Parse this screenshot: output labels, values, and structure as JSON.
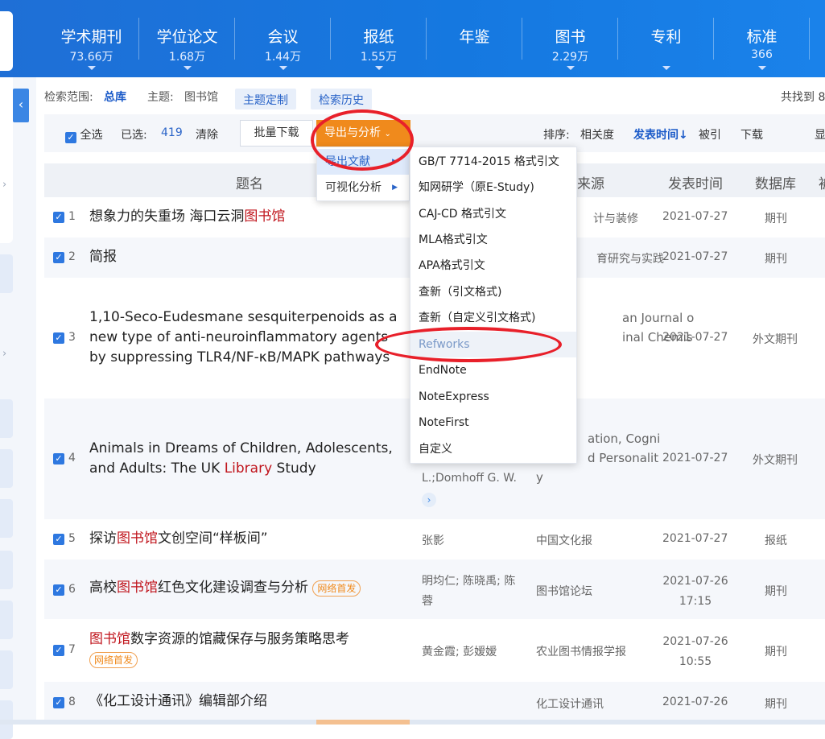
{
  "databases": [
    {
      "name": "学术期刊",
      "count": "73.66万"
    },
    {
      "name": "学位论文",
      "count": "1.68万"
    },
    {
      "name": "会议",
      "count": "1.44万"
    },
    {
      "name": "报纸",
      "count": "1.55万"
    },
    {
      "name": "年鉴",
      "count": ""
    },
    {
      "name": "图书",
      "count": "2.29万"
    },
    {
      "name": "专利",
      "count": ""
    },
    {
      "name": "标准",
      "count": "366"
    }
  ],
  "filter": {
    "scope_label": "检索范围:",
    "scope_value": "总库",
    "topic_label": "主题:",
    "topic_value": "图书馆",
    "customize_button": "主题定制",
    "history_button": "检索历史",
    "found_label": "共找到 8"
  },
  "toolbar": {
    "select_all": "全选",
    "selected_label": "已选:",
    "selected_count": "419",
    "clear": "清除",
    "batch_download": "批量下载",
    "export_analyze": "导出与分析",
    "sort_label": "排序:",
    "sort_relevance": "相关度",
    "sort_date": "发表时间",
    "sort_cited": "被引",
    "sort_download": "下载",
    "display": "显"
  },
  "table_headers": {
    "title": "题名",
    "source": "来源",
    "date": "发表时间",
    "database": "数据库",
    "extra": "被"
  },
  "menu_level1": [
    {
      "label": "导出文献"
    },
    {
      "label": "可视化分析"
    }
  ],
  "menu_level2": [
    {
      "label": "GB/T 7714-2015 格式引文"
    },
    {
      "label": "知网研学（原E-Study)"
    },
    {
      "label": "CAJ-CD 格式引文"
    },
    {
      "label": "MLA格式引文"
    },
    {
      "label": "APA格式引文"
    },
    {
      "label": "查新（引文格式)"
    },
    {
      "label": "查新（自定义引文格式)"
    },
    {
      "label": "Refworks"
    },
    {
      "label": "EndNote"
    },
    {
      "label": "NoteExpress"
    },
    {
      "label": "NoteFirst"
    },
    {
      "label": "自定义"
    }
  ],
  "rows": [
    {
      "num": "1",
      "title_a": "想象力的失重场 海口云洞",
      "title_hl": "图书馆",
      "title_b": "",
      "author": "",
      "source": "计与装修",
      "date": "2021-07-27",
      "time": "",
      "db": "期刊"
    },
    {
      "num": "2",
      "title_a": "简报",
      "title_hl": "",
      "title_b": "",
      "author": "",
      "source": "育研究与实践",
      "date": "2021-07-27",
      "time": "",
      "db": "期刊"
    },
    {
      "num": "3",
      "title_line1": "1,10-Seco-Eudesmane sesquiterpenoids as a",
      "title_line2": "new type of anti-neuroinflammatory agents",
      "title_line3": "by suppressing TLR4/NF-κB/MAPK pathways",
      "source_line1": "an Journal o",
      "source_line2": "inal Chemis",
      "date": "2021-07-27",
      "db": "外文期刊"
    },
    {
      "num": "4",
      "title_line1": "Animals in Dreams of Children, Adolescents,",
      "title_line2_a": "and Adults: The UK ",
      "title_line2_hl": "Library",
      "title_line2_b": " Study",
      "author_line": "L.;Domhoff G. W.",
      "source_line1": "ation, Cogni",
      "source_line2": "d Personalit",
      "source_line3": "y",
      "date": "2021-07-27",
      "db": "外文期刊"
    },
    {
      "num": "5",
      "title_a": "探访",
      "title_hl": "图书馆",
      "title_b": "文创空间“样板间”",
      "author": "张影",
      "source": "中国文化报",
      "date": "2021-07-27",
      "db": "报纸"
    },
    {
      "num": "6",
      "title_a": "高校",
      "title_hl": "图书馆",
      "title_b": "红色文化建设调查与分析",
      "tag": "网络首发",
      "author_line1": "明均仁; 陈晓禹; 陈",
      "author_line2": "蓉",
      "source": "图书馆论坛",
      "date": "2021-07-26",
      "time": "17:15",
      "db": "期刊"
    },
    {
      "num": "7",
      "title_hl": "图书馆",
      "title_b": "数字资源的馆藏保存与服务策略思考",
      "tag": "网络首发",
      "author": "黄金霞; 彭嫒嫒",
      "source": "农业图书情报学报",
      "date": "2021-07-26",
      "time": "10:55",
      "db": "期刊"
    },
    {
      "num": "8",
      "title_a": "《化工设计通讯》编辑部介绍",
      "author": "",
      "source": "化工设计通讯",
      "date": "2021-07-26",
      "db": "期刊"
    }
  ]
}
